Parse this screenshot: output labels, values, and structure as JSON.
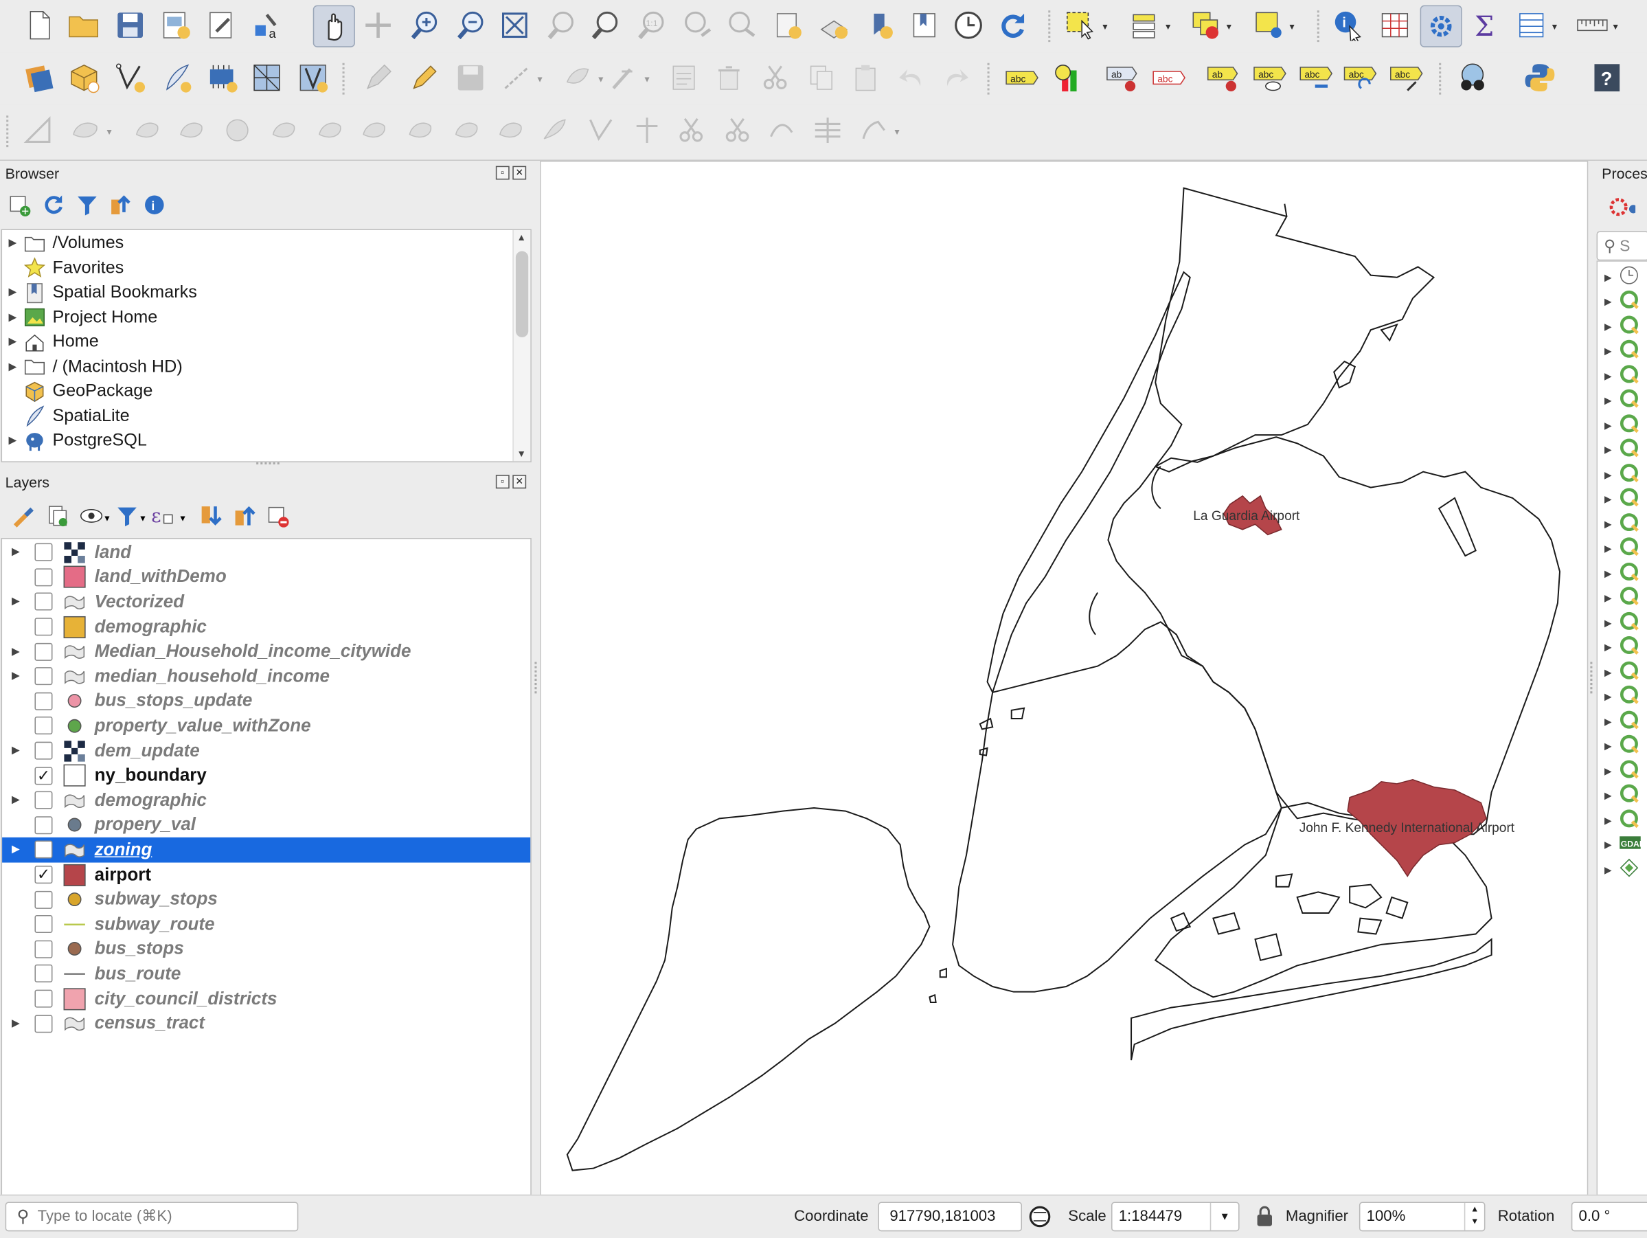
{
  "browser": {
    "title": "Browser",
    "items": [
      {
        "label": "/Volumes",
        "has_children": true,
        "icon": "folder-icon"
      },
      {
        "label": "Favorites",
        "has_children": false,
        "icon": "star-icon"
      },
      {
        "label": "Spatial Bookmarks",
        "has_children": true,
        "icon": "bookmark-icon"
      },
      {
        "label": "Project Home",
        "has_children": true,
        "icon": "project-home-icon"
      },
      {
        "label": "Home",
        "has_children": true,
        "icon": "home-icon"
      },
      {
        "label": "/ (Macintosh HD)",
        "has_children": true,
        "icon": "folder-icon"
      },
      {
        "label": "GeoPackage",
        "has_children": false,
        "icon": "geopackage-icon"
      },
      {
        "label": "SpatiaLite",
        "has_children": false,
        "icon": "spatialite-icon"
      },
      {
        "label": "PostgreSQL",
        "has_children": true,
        "icon": "postgresql-icon"
      }
    ]
  },
  "layers": {
    "title": "Layers",
    "items": [
      {
        "label": "land",
        "expandable": true,
        "checked": false,
        "symbol": "raster",
        "color": "#1d2b44"
      },
      {
        "label": "land_withDemo",
        "expandable": false,
        "checked": false,
        "symbol": "fill",
        "color": "#e46c86"
      },
      {
        "label": "Vectorized",
        "expandable": true,
        "checked": false,
        "symbol": "category",
        "color": "#cccccc"
      },
      {
        "label": "demographic",
        "expandable": false,
        "checked": false,
        "symbol": "fill",
        "color": "#e7b237"
      },
      {
        "label": "Median_Household_income_citywide",
        "expandable": true,
        "checked": false,
        "symbol": "category",
        "color": "#cccccc"
      },
      {
        "label": "median_household_income",
        "expandable": true,
        "checked": false,
        "symbol": "category",
        "color": "#cccccc"
      },
      {
        "label": "bus_stops_update",
        "expandable": false,
        "checked": false,
        "symbol": "point",
        "color": "#ec93a6"
      },
      {
        "label": "property_value_withZone",
        "expandable": false,
        "checked": false,
        "symbol": "point",
        "color": "#5ea64b"
      },
      {
        "label": "dem_update",
        "expandable": true,
        "checked": false,
        "symbol": "raster",
        "color": "#1d2b44"
      },
      {
        "label": "ny_boundary",
        "expandable": false,
        "checked": true,
        "symbol": "outline",
        "color": "#ffffff"
      },
      {
        "label": "demographic",
        "expandable": true,
        "checked": false,
        "symbol": "category",
        "color": "#cccccc"
      },
      {
        "label": "propery_val",
        "expandable": false,
        "checked": false,
        "symbol": "point",
        "color": "#6a7b8d"
      },
      {
        "label": "zoning",
        "expandable": true,
        "checked": false,
        "symbol": "category",
        "color": "#cccccc",
        "selected": true
      },
      {
        "label": "airport",
        "expandable": false,
        "checked": true,
        "symbol": "fill",
        "color": "#b5454a"
      },
      {
        "label": "subway_stops",
        "expandable": false,
        "checked": false,
        "symbol": "point",
        "color": "#d8a52b"
      },
      {
        "label": "subway_route",
        "expandable": false,
        "checked": false,
        "symbol": "line",
        "color": "#b9c94d"
      },
      {
        "label": "bus_stops",
        "expandable": false,
        "checked": false,
        "symbol": "point",
        "color": "#9a6a50"
      },
      {
        "label": "bus_route",
        "expandable": false,
        "checked": false,
        "symbol": "line",
        "color": "#777777"
      },
      {
        "label": "city_council_districts",
        "expandable": false,
        "checked": false,
        "symbol": "fill",
        "color": "#f0a3ae"
      },
      {
        "label": "census_tract",
        "expandable": true,
        "checked": false,
        "symbol": "category",
        "color": "#cccccc"
      }
    ]
  },
  "map": {
    "labels": {
      "laguardia": "La Guardia Airport",
      "jfk": "John F. Kennedy International Airport"
    },
    "airport_color": "#b5454a"
  },
  "processing": {
    "title": "Proces",
    "search_placeholder": "S"
  },
  "status": {
    "locate_placeholder": "Type to locate (⌘K)",
    "coordinate_label": "Coordinate",
    "coordinate_value": "917790,181003",
    "scale_label": "Scale",
    "scale_value": "1:184479",
    "magnifier_label": "Magnifier",
    "magnifier_value": "100%",
    "rotation_label": "Rotation",
    "rotation_value": "0.0 °"
  }
}
